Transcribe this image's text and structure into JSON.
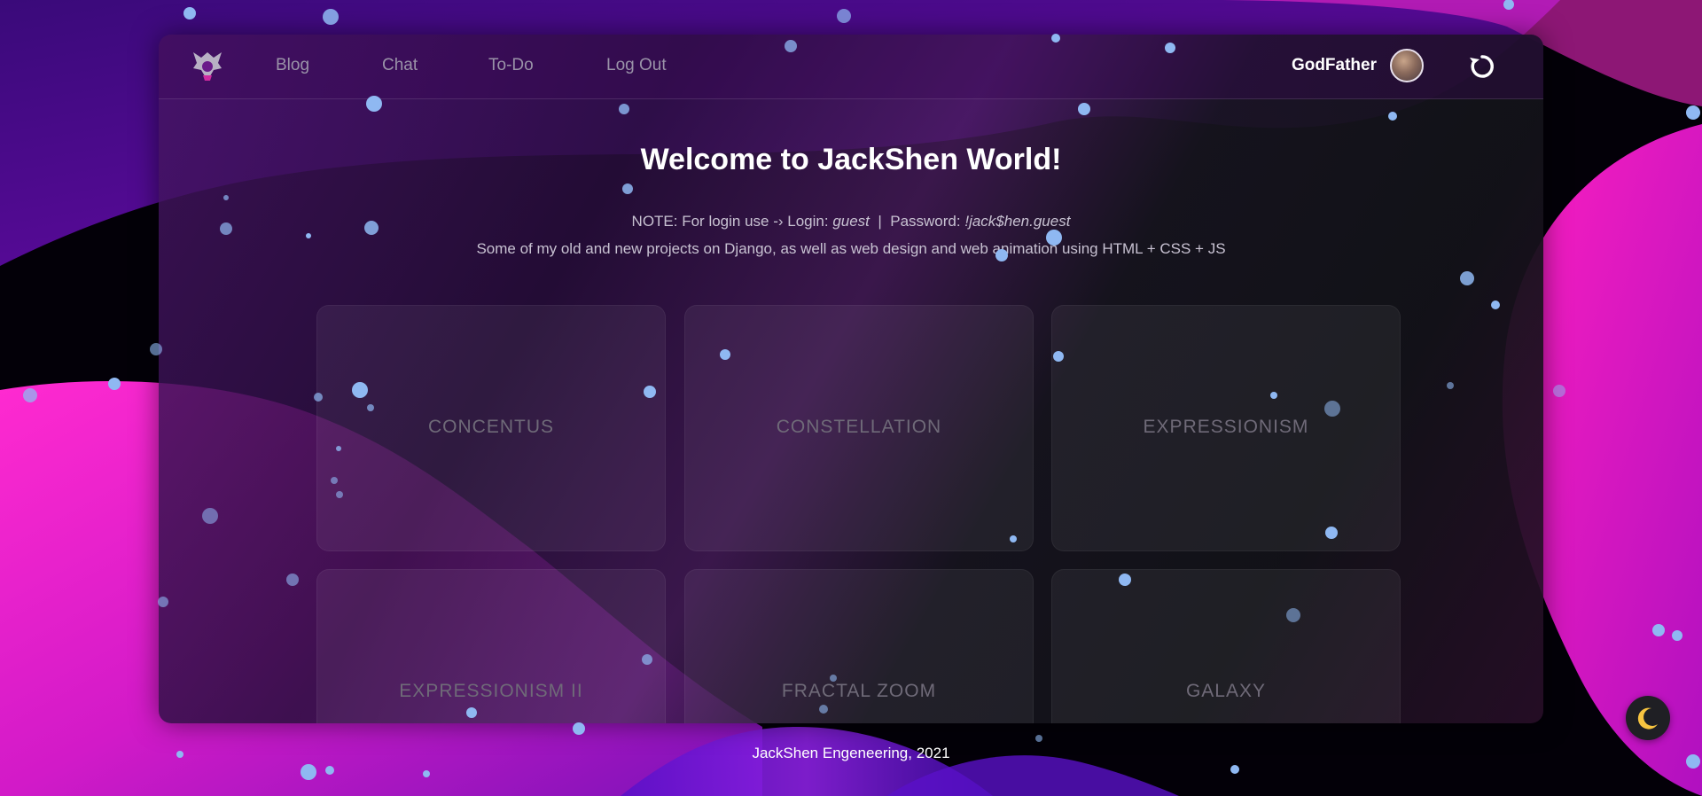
{
  "nav": {
    "links": [
      "Blog",
      "Chat",
      "To-Do",
      "Log Out"
    ],
    "username": "GodFather"
  },
  "hero": {
    "title": "Welcome to JackShen World!",
    "note_prefix": "NOTE: For login use -› Login:",
    "login_value": "guest",
    "separator": "|",
    "password_label": "Password:",
    "password_value": "!jack$hen.guest",
    "description": "Some of my old and new projects on Django, as well as web design and web animation using HTML + CSS + JS"
  },
  "cards": [
    "CONCENTUS",
    "CONSTELLATION",
    "EXPRESSIONISM",
    "EXPRESSIONISM II",
    "FRACTAL ZOOM",
    "GALAXY"
  ],
  "footer": {
    "text": "JackShen Engeneering, 2021"
  },
  "icons": {
    "logo": "eagle-logo-icon",
    "refresh": "refresh-icon",
    "theme": "moon-icon"
  },
  "colors": {
    "accent_pink": "#ff1fc0",
    "accent_purple": "#5a0a8a",
    "dot_blue": "#8fb8f2",
    "moon_yellow": "#f7c440"
  }
}
